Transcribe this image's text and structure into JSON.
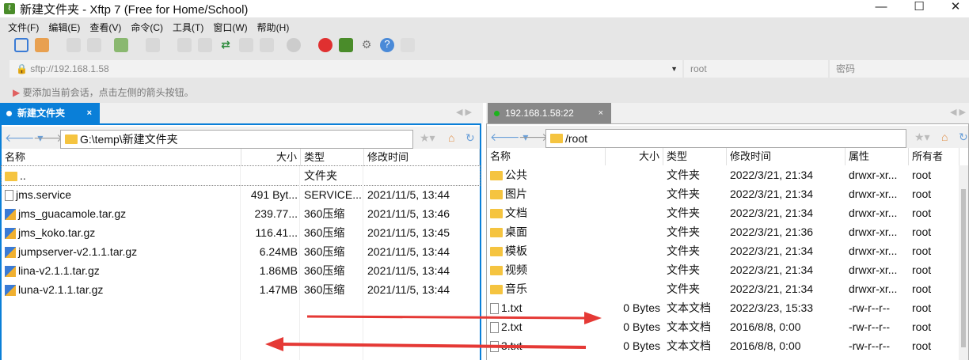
{
  "window": {
    "title": "新建文件夹 - Xftp 7 (Free for Home/School)",
    "minimize": "—",
    "maximize": "☐",
    "close": "✕"
  },
  "menu": [
    "文件(F)",
    "编辑(E)",
    "查看(V)",
    "命令(C)",
    "工具(T)",
    "窗口(W)",
    "帮助(H)"
  ],
  "address": {
    "url": "sftp://192.168.1.58",
    "user": "root",
    "password_placeholder": "密码"
  },
  "hint": "要添加当前会话，点击左侧的箭头按钮。",
  "left": {
    "tab": "新建文件夹",
    "path": "G:\\temp\\新建文件夹",
    "headers": [
      "名称",
      "大小",
      "类型",
      "修改时间"
    ],
    "rows": [
      {
        "name": "..",
        "size": "",
        "type": "文件夹",
        "mtime": "",
        "icon": "folder"
      },
      {
        "name": "jms.service",
        "size": "491 Byt...",
        "type": "SERVICE...",
        "mtime": "2021/11/5, 13:44",
        "icon": "file"
      },
      {
        "name": "jms_guacamole.tar.gz",
        "size": "239.77...",
        "type": "360压缩",
        "mtime": "2021/11/5, 13:46",
        "icon": "archive"
      },
      {
        "name": "jms_koko.tar.gz",
        "size": "116.41...",
        "type": "360压缩",
        "mtime": "2021/11/5, 13:45",
        "icon": "archive"
      },
      {
        "name": "jumpserver-v2.1.1.tar.gz",
        "size": "6.24MB",
        "type": "360压缩",
        "mtime": "2021/11/5, 13:44",
        "icon": "archive"
      },
      {
        "name": "lina-v2.1.1.tar.gz",
        "size": "1.86MB",
        "type": "360压缩",
        "mtime": "2021/11/5, 13:44",
        "icon": "archive"
      },
      {
        "name": "luna-v2.1.1.tar.gz",
        "size": "1.47MB",
        "type": "360压缩",
        "mtime": "2021/11/5, 13:44",
        "icon": "archive"
      }
    ]
  },
  "right": {
    "tab": "192.168.1.58:22",
    "path": "/root",
    "headers": [
      "名称",
      "大小",
      "类型",
      "修改时间",
      "属性",
      "所有者"
    ],
    "rows": [
      {
        "name": "公共",
        "size": "",
        "type": "文件夹",
        "mtime": "2022/3/21, 21:34",
        "attr": "drwxr-xr...",
        "owner": "root",
        "icon": "folder"
      },
      {
        "name": "图片",
        "size": "",
        "type": "文件夹",
        "mtime": "2022/3/21, 21:34",
        "attr": "drwxr-xr...",
        "owner": "root",
        "icon": "folder"
      },
      {
        "name": "文档",
        "size": "",
        "type": "文件夹",
        "mtime": "2022/3/21, 21:34",
        "attr": "drwxr-xr...",
        "owner": "root",
        "icon": "folder"
      },
      {
        "name": "桌面",
        "size": "",
        "type": "文件夹",
        "mtime": "2022/3/21, 21:36",
        "attr": "drwxr-xr...",
        "owner": "root",
        "icon": "folder"
      },
      {
        "name": "模板",
        "size": "",
        "type": "文件夹",
        "mtime": "2022/3/21, 21:34",
        "attr": "drwxr-xr...",
        "owner": "root",
        "icon": "folder"
      },
      {
        "name": "视频",
        "size": "",
        "type": "文件夹",
        "mtime": "2022/3/21, 21:34",
        "attr": "drwxr-xr...",
        "owner": "root",
        "icon": "folder"
      },
      {
        "name": "音乐",
        "size": "",
        "type": "文件夹",
        "mtime": "2022/3/21, 21:34",
        "attr": "drwxr-xr...",
        "owner": "root",
        "icon": "folder"
      },
      {
        "name": "1.txt",
        "size": "0 Bytes",
        "type": "文本文档",
        "mtime": "2022/3/23, 15:33",
        "attr": "-rw-r--r--",
        "owner": "root",
        "icon": "file"
      },
      {
        "name": "2.txt",
        "size": "0 Bytes",
        "type": "文本文档",
        "mtime": "2016/8/8, 0:00",
        "attr": "-rw-r--r--",
        "owner": "root",
        "icon": "file"
      },
      {
        "name": "3.txt",
        "size": "0 Bytes",
        "type": "文本文档",
        "mtime": "2016/8/8, 0:00",
        "attr": "-rw-r--r--",
        "owner": "root",
        "icon": "file"
      }
    ]
  },
  "colors": {
    "accent": "#0a7fd8",
    "connected": "#1db31d",
    "arrow": "#e53935"
  }
}
